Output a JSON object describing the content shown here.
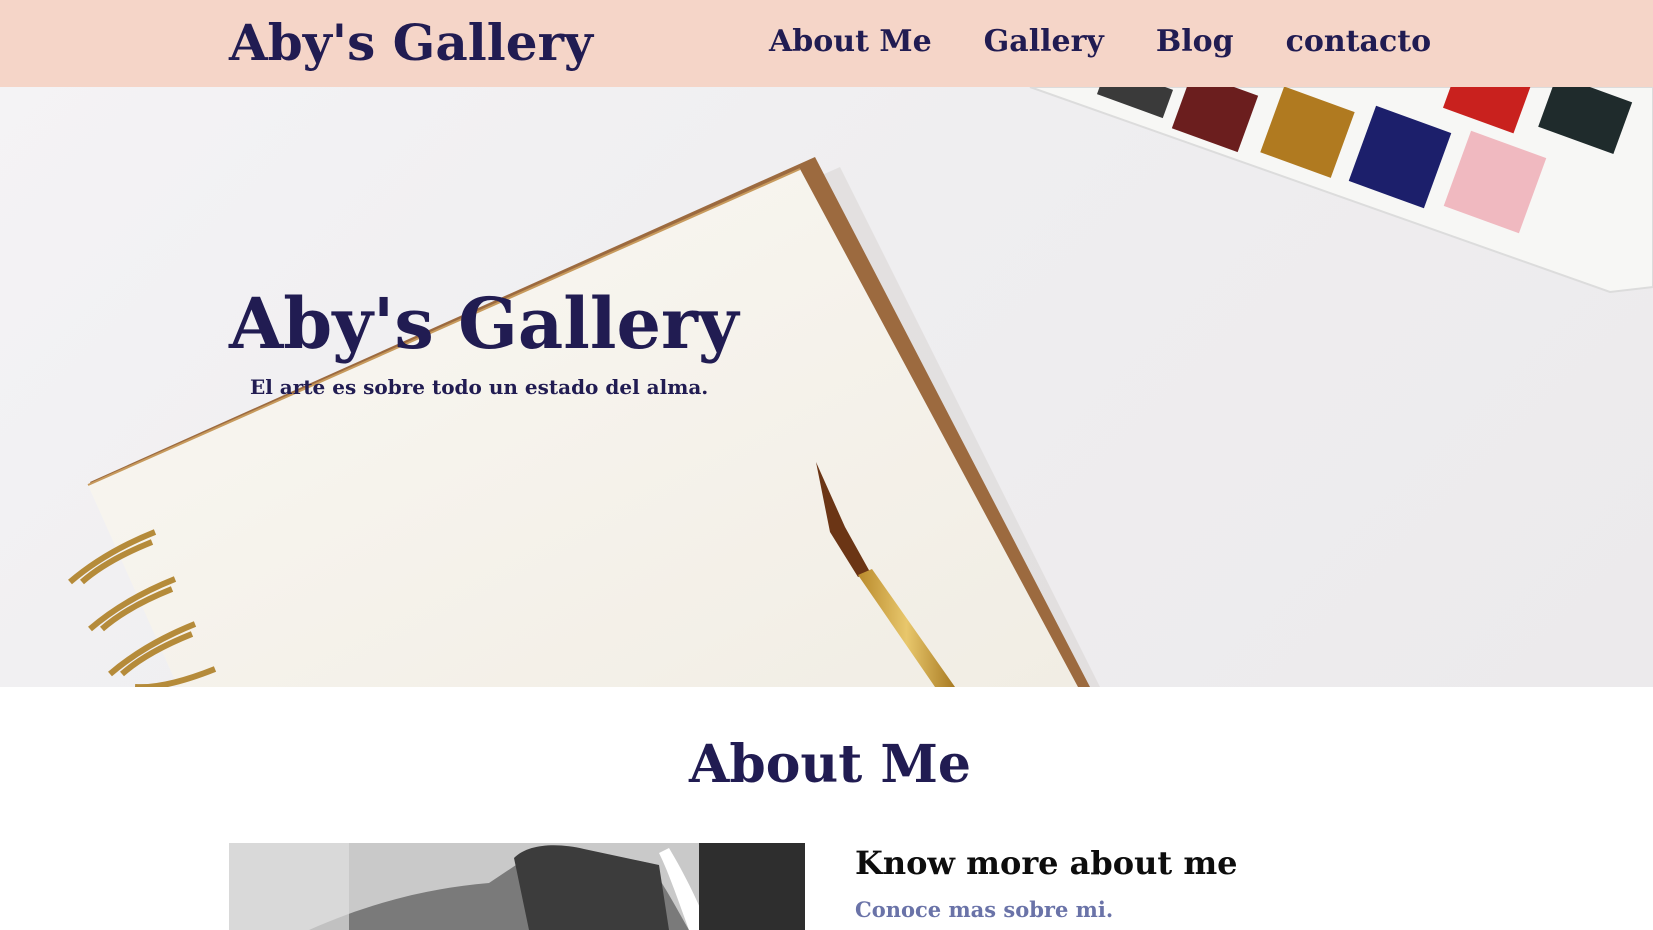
{
  "navbar": {
    "brand": "Aby's Gallery",
    "links": [
      {
        "label": "About Me"
      },
      {
        "label": "Gallery"
      },
      {
        "label": "Blog"
      },
      {
        "label": "contacto"
      }
    ]
  },
  "hero": {
    "title": "Aby's Gallery",
    "tagline": "El arte es sobre todo un estado del alma."
  },
  "about": {
    "title": "About Me",
    "heading": "Know more about me",
    "subheading": "Conoce mas sobre mi."
  },
  "colors": {
    "navbar_bg": "#f5d5c8",
    "primary_text": "#211c52",
    "subheading_text": "#6a73a8"
  }
}
